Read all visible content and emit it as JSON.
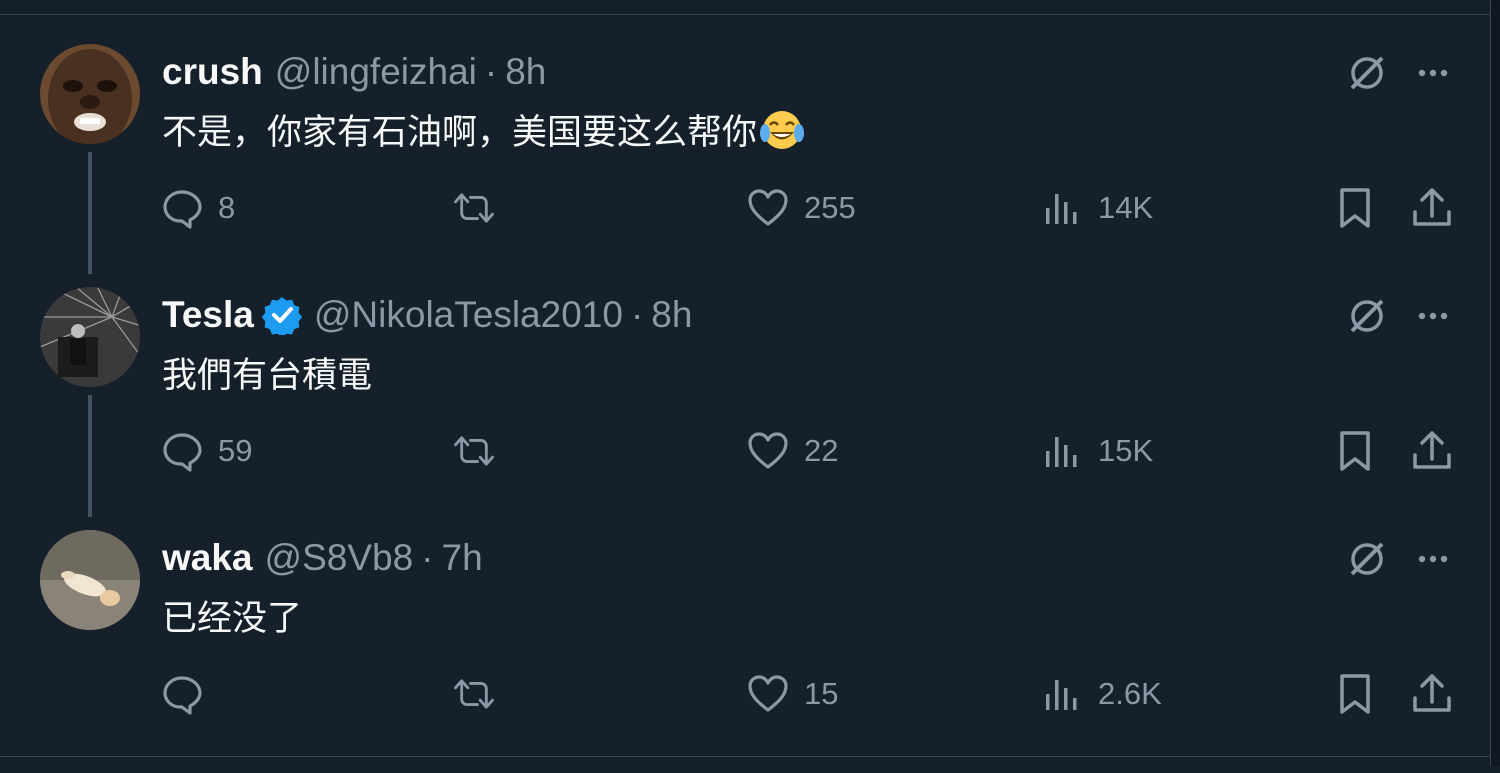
{
  "tweets": [
    {
      "name": "crush",
      "handle": "@lingfeizhai",
      "time": "8h",
      "text": "不是，你家有石油啊，美国要这么帮你",
      "emoji": "face-with-tears-of-joy",
      "verified": false,
      "replies": "8",
      "retweets": "",
      "likes": "255",
      "views": "14K"
    },
    {
      "name": "Tesla",
      "handle": "@NikolaTesla2010",
      "time": "8h",
      "text": "我們有台積電",
      "verified": true,
      "replies": "59",
      "retweets": "",
      "likes": "22",
      "views": "15K"
    },
    {
      "name": "waka",
      "handle": "@S8Vb8",
      "time": "7h",
      "text": "已经没了",
      "verified": false,
      "replies": "",
      "retweets": "",
      "likes": "15",
      "views": "2.6K"
    }
  ],
  "separator": "·",
  "colors": {
    "background": "#15202b",
    "text": "#f7f9f9",
    "muted": "#8b98a5",
    "verified": "#1d9bf0",
    "thread_line": "#425363"
  },
  "icons": [
    "grok-icon",
    "more-icon",
    "reply-icon",
    "retweet-icon",
    "like-icon",
    "views-icon",
    "bookmark-icon",
    "share-icon"
  ]
}
